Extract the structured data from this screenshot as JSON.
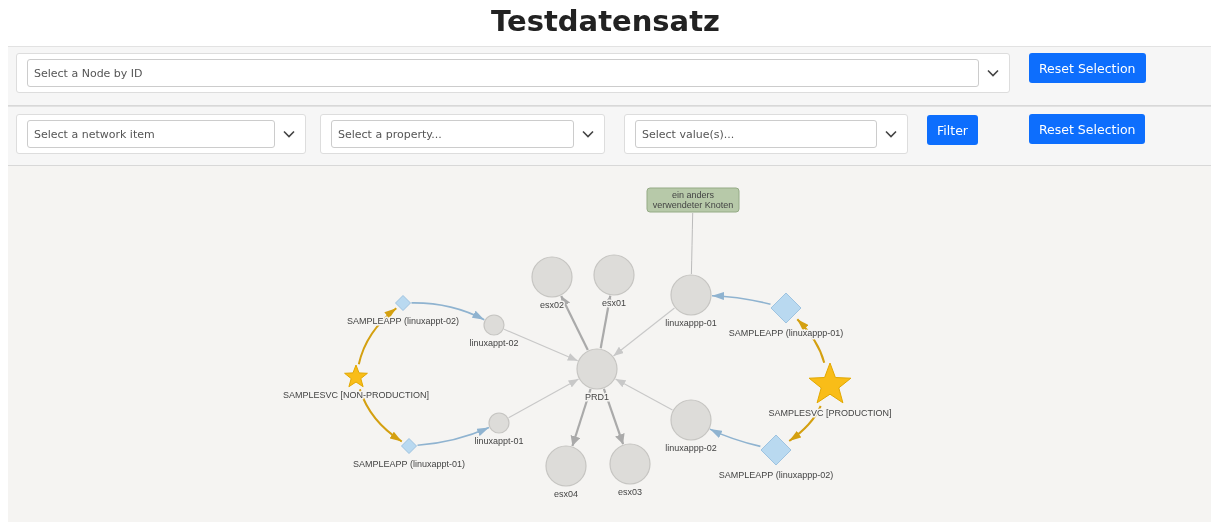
{
  "title": "Testdatensatz",
  "node_select": {
    "placeholder": "Select a Node by ID"
  },
  "reset_button_top": "Reset Selection",
  "filters": [
    {
      "placeholder": "Select a network item"
    },
    {
      "placeholder": "Select a property..."
    },
    {
      "placeholder": "Select value(s)..."
    }
  ],
  "filter_button": "Filter",
  "reset_button_bottom": "Reset Selection",
  "graph": {
    "nodes": [
      {
        "kind": "note",
        "label": "ein anders verwendeter Knoten"
      },
      {
        "kind": "host",
        "label": "esx02"
      },
      {
        "kind": "host",
        "label": "esx01"
      },
      {
        "kind": "host",
        "label": "linuxappp-01"
      },
      {
        "kind": "app",
        "label": "SAMPLEAPP (linuxappt-02)"
      },
      {
        "kind": "host",
        "label": "linuxappt-02"
      },
      {
        "kind": "app",
        "label": "SAMPLEAPP (linuxappp-01)"
      },
      {
        "kind": "host",
        "label": "PRD1"
      },
      {
        "kind": "service",
        "label": "SAMPLESVC [NON-PRODUCTION]"
      },
      {
        "kind": "service",
        "label": "SAMPLESVC [PRODUCTION]"
      },
      {
        "kind": "host",
        "label": "linuxappt-01"
      },
      {
        "kind": "host",
        "label": "linuxappp-02"
      },
      {
        "kind": "app",
        "label": "SAMPLEAPP (linuxappt-01)"
      },
      {
        "kind": "host",
        "label": "esx04"
      },
      {
        "kind": "host",
        "label": "esx03"
      },
      {
        "kind": "app",
        "label": "SAMPLEAPP (linuxappp-02)"
      }
    ]
  }
}
